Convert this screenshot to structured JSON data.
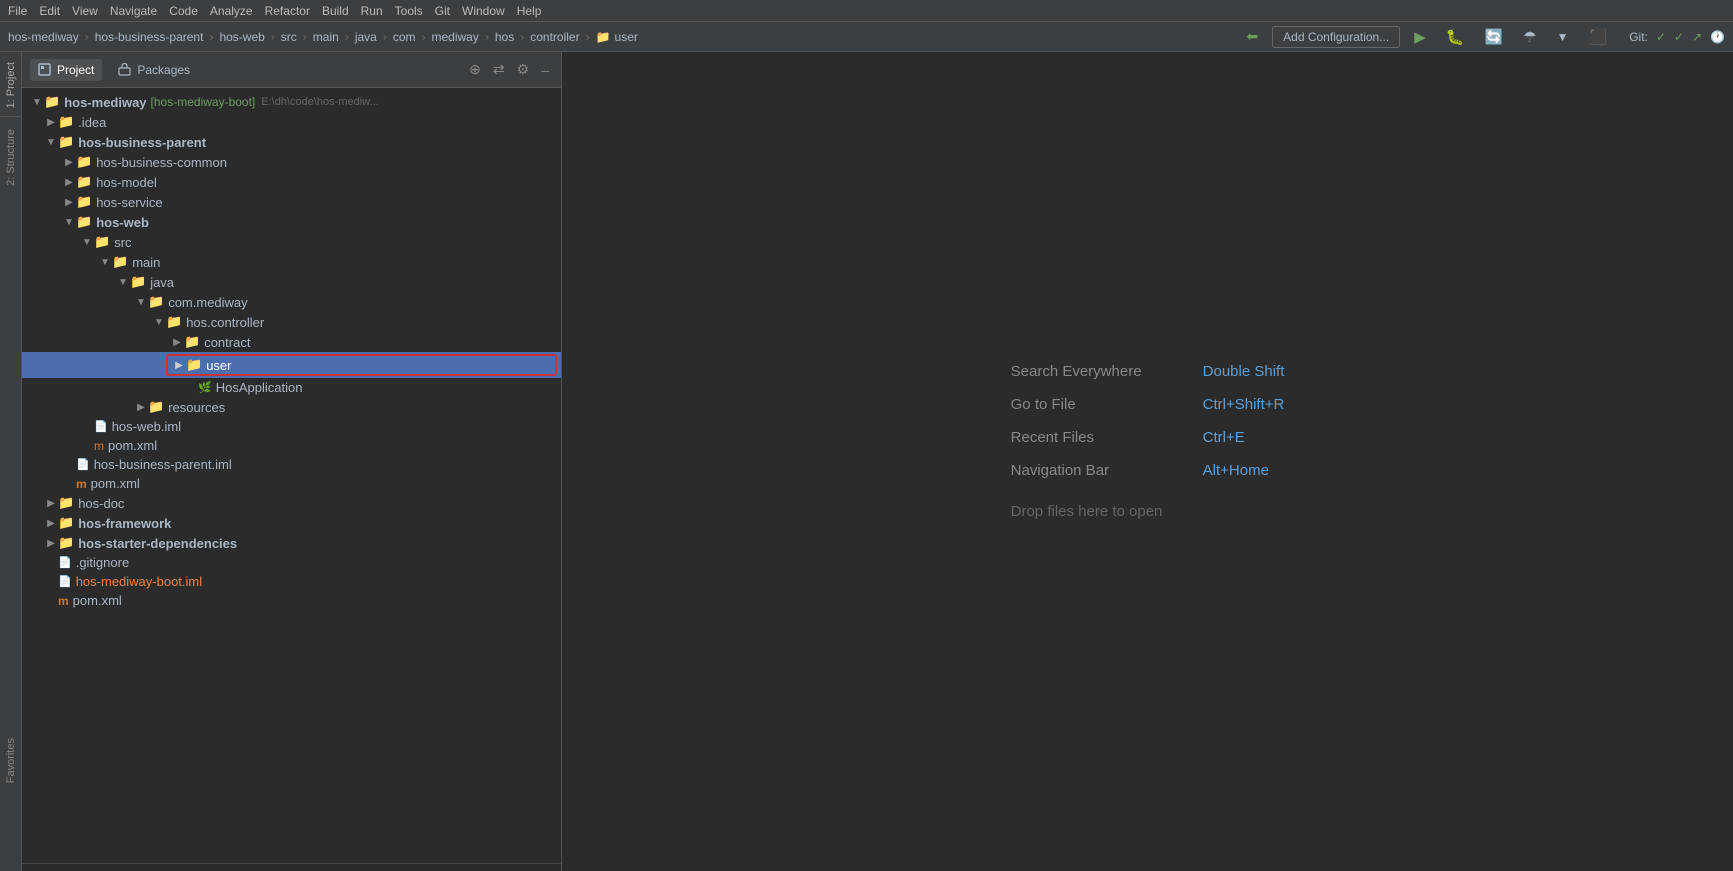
{
  "menubar": {
    "items": [
      "File",
      "Edit",
      "View",
      "Navigate",
      "Code",
      "Analyze",
      "Refactor",
      "Build",
      "Run",
      "Tools",
      "Git",
      "Window",
      "Help"
    ]
  },
  "breadcrumb": {
    "items": [
      "hos-mediway",
      "hos-business-parent",
      "hos-web",
      "src",
      "main",
      "java",
      "com",
      "mediway",
      "hos",
      "controller",
      "user"
    ],
    "folder_icon": "📁"
  },
  "toolbar": {
    "add_config_label": "Add Configuration...",
    "git_label": "Git:",
    "git_icons": [
      "✓",
      "✓",
      "↗",
      "🕐"
    ]
  },
  "panel": {
    "tab_project": "Project",
    "tab_packages": "Packages",
    "icons": {
      "globe": "⊕",
      "split": "⇄",
      "gear": "⚙",
      "minimize": "–"
    }
  },
  "tree": {
    "root": {
      "label": "hos-mediway",
      "badge": "[hos-mediway-boot]",
      "path": "E:\\dh\\code\\hos-mediw...",
      "expanded": true
    },
    "items": [
      {
        "id": "idea",
        "label": ".idea",
        "indent": 1,
        "type": "folder",
        "state": "collapsed"
      },
      {
        "id": "hos-business-parent",
        "label": "hos-business-parent",
        "indent": 1,
        "type": "folder",
        "state": "expanded",
        "bold": true
      },
      {
        "id": "hos-business-common",
        "label": "hos-business-common",
        "indent": 2,
        "type": "folder",
        "state": "collapsed"
      },
      {
        "id": "hos-model",
        "label": "hos-model",
        "indent": 2,
        "type": "folder",
        "state": "collapsed"
      },
      {
        "id": "hos-service",
        "label": "hos-service",
        "indent": 2,
        "type": "folder",
        "state": "collapsed"
      },
      {
        "id": "hos-web",
        "label": "hos-web",
        "indent": 2,
        "type": "folder",
        "state": "expanded",
        "bold": true
      },
      {
        "id": "src",
        "label": "src",
        "indent": 3,
        "type": "folder",
        "state": "expanded"
      },
      {
        "id": "main",
        "label": "main",
        "indent": 4,
        "type": "folder",
        "state": "expanded"
      },
      {
        "id": "java",
        "label": "java",
        "indent": 5,
        "type": "folder-blue",
        "state": "expanded"
      },
      {
        "id": "com.mediway",
        "label": "com.mediway",
        "indent": 6,
        "type": "folder",
        "state": "expanded"
      },
      {
        "id": "hos.controller",
        "label": "hos.controller",
        "indent": 7,
        "type": "folder",
        "state": "expanded"
      },
      {
        "id": "contract",
        "label": "contract",
        "indent": 8,
        "type": "folder",
        "state": "collapsed"
      },
      {
        "id": "user",
        "label": "user",
        "indent": 8,
        "type": "folder",
        "state": "collapsed",
        "selected": true,
        "red-border": true
      },
      {
        "id": "HosApplication",
        "label": "HosApplication",
        "indent": 8,
        "type": "file-spring"
      },
      {
        "id": "resources",
        "label": "resources",
        "indent": 6,
        "type": "folder",
        "state": "collapsed"
      },
      {
        "id": "hos-web.iml",
        "label": "hos-web.iml",
        "indent": 4,
        "type": "file-iml"
      },
      {
        "id": "pom1.xml",
        "label": "pom.xml",
        "indent": 4,
        "type": "file-xml"
      },
      {
        "id": "hos-business-parent.iml",
        "label": "hos-business-parent.iml",
        "indent": 3,
        "type": "file-iml"
      },
      {
        "id": "pom2.xml",
        "label": "pom.xml",
        "indent": 3,
        "type": "file-xml"
      },
      {
        "id": "hos-doc",
        "label": "hos-doc",
        "indent": 1,
        "type": "folder",
        "state": "collapsed"
      },
      {
        "id": "hos-framework",
        "label": "hos-framework",
        "indent": 1,
        "type": "folder",
        "state": "collapsed",
        "bold": true
      },
      {
        "id": "hos-starter-dependencies",
        "label": "hos-starter-dependencies",
        "indent": 1,
        "type": "folder",
        "state": "collapsed",
        "bold": true
      },
      {
        "id": ".gitignore",
        "label": ".gitignore",
        "indent": 1,
        "type": "file-git"
      },
      {
        "id": "hos-mediway-boot.iml",
        "label": "hos-mediway-boot.iml",
        "indent": 1,
        "type": "file-iml",
        "highlight": true
      },
      {
        "id": "pom3.xml",
        "label": "pom.xml",
        "indent": 1,
        "type": "file-xml"
      }
    ]
  },
  "editor": {
    "hint1_label": "Search Everywhere",
    "hint1_key": "Double Shift",
    "hint2_label": "Go to File",
    "hint2_key": "Ctrl+Shift+R",
    "hint3_label": "Recent Files",
    "hint3_key": "Ctrl+E",
    "hint4_label": "Navigation Bar",
    "hint4_key": "Alt+Home",
    "hint5_label": "Drop files here to open",
    "hint5_key": ""
  },
  "sidebars": {
    "left_top": "1: Project",
    "left_structure": "2: Structure",
    "left_favorites": "Favorites"
  }
}
